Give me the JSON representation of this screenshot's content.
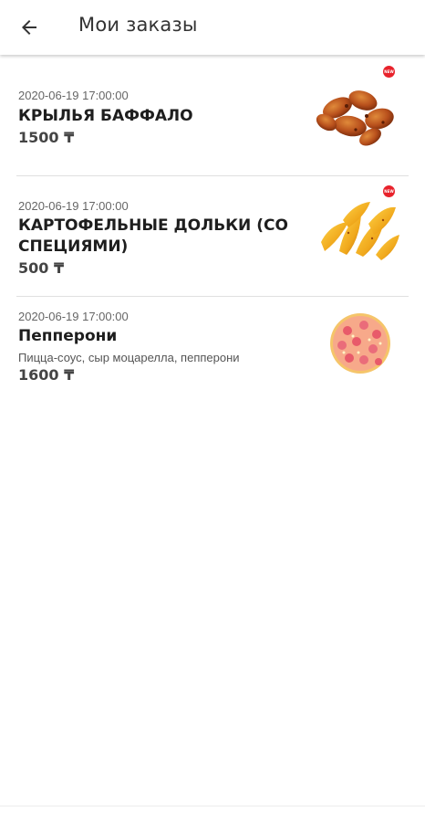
{
  "header": {
    "title": "Мои заказы",
    "back_icon": "arrow-left-icon"
  },
  "orders": [
    {
      "date": "2020-06-19 17:00:00",
      "name": "КРЫЛЬЯ БАФФАЛО",
      "price": "1500 ₸",
      "image": "chicken-wings-image",
      "badge": "NEW"
    },
    {
      "date": "2020-06-19 17:00:00",
      "name": "КАРТОФЕЛЬНЫЕ ДОЛЬКИ (СО СПЕЦИЯМИ)",
      "price": "500 ₸",
      "image": "potato-wedges-image",
      "badge": "NEW"
    },
    {
      "date": "2020-06-19 17:00:00",
      "name": "Пепперони",
      "description": "Пицца-соус, сыр моцарелла, пепперони",
      "price": "1600 ₸",
      "image": "pepperoni-pizza-image"
    }
  ],
  "colors": {
    "badge": "#e8222b",
    "divider": "#e0e0e0"
  }
}
